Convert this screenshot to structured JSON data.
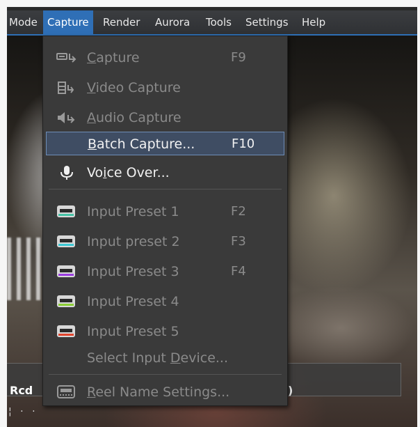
{
  "menubar": {
    "items": [
      {
        "label": "Mode"
      },
      {
        "label": "Capture"
      },
      {
        "label": "Render"
      },
      {
        "label": "Aurora"
      },
      {
        "label": "Tools"
      },
      {
        "label": "Settings"
      },
      {
        "label": "Help"
      }
    ]
  },
  "capture_menu": {
    "capture": {
      "pre": "",
      "u": "C",
      "post": "apture",
      "shortcut": "F9",
      "icon": "capture-icon"
    },
    "video_capture": {
      "pre": "",
      "u": "V",
      "post": "ideo Capture",
      "icon": "video-capture-icon"
    },
    "audio_capture": {
      "pre": "",
      "u": "A",
      "post": "udio Capture",
      "icon": "audio-capture-icon"
    },
    "batch_capture": {
      "pre": "",
      "u": "B",
      "post": "atch Capture...",
      "shortcut": "F10"
    },
    "voice_over": {
      "pre": "Vo",
      "u": "i",
      "post": "ce Over...",
      "icon": "microphone-icon"
    },
    "input_presets": [
      {
        "label": "Input Preset 1",
        "shortcut": "F2",
        "color": "#46c3a6"
      },
      {
        "label": "Input preset 2",
        "shortcut": "F3",
        "color": "#3dc9d4"
      },
      {
        "label": "Input Preset 3",
        "shortcut": "F4",
        "color": "#9b3de0"
      },
      {
        "label": "Input Preset 4",
        "shortcut": "",
        "color": "#8ccf35"
      },
      {
        "label": "Input Preset 5",
        "shortcut": "",
        "color": "#e2452e"
      }
    ],
    "select_input_device": {
      "pre": "Select Input ",
      "u": "D",
      "post": "evice..."
    },
    "reel_name_settings": {
      "pre": "",
      "u": "R",
      "post": "eel Name Settings...",
      "icon": "reel-name-icon"
    }
  },
  "video_overlay": {
    "label": "Rcd",
    "dots": "¦ · ·",
    "bracket": ")"
  },
  "colors": {
    "menubar_active": "#2f6fb6",
    "menu_bg": "#3a3a3a",
    "highlight_bg": "#3f4d63",
    "highlight_border": "#6e8db8"
  }
}
